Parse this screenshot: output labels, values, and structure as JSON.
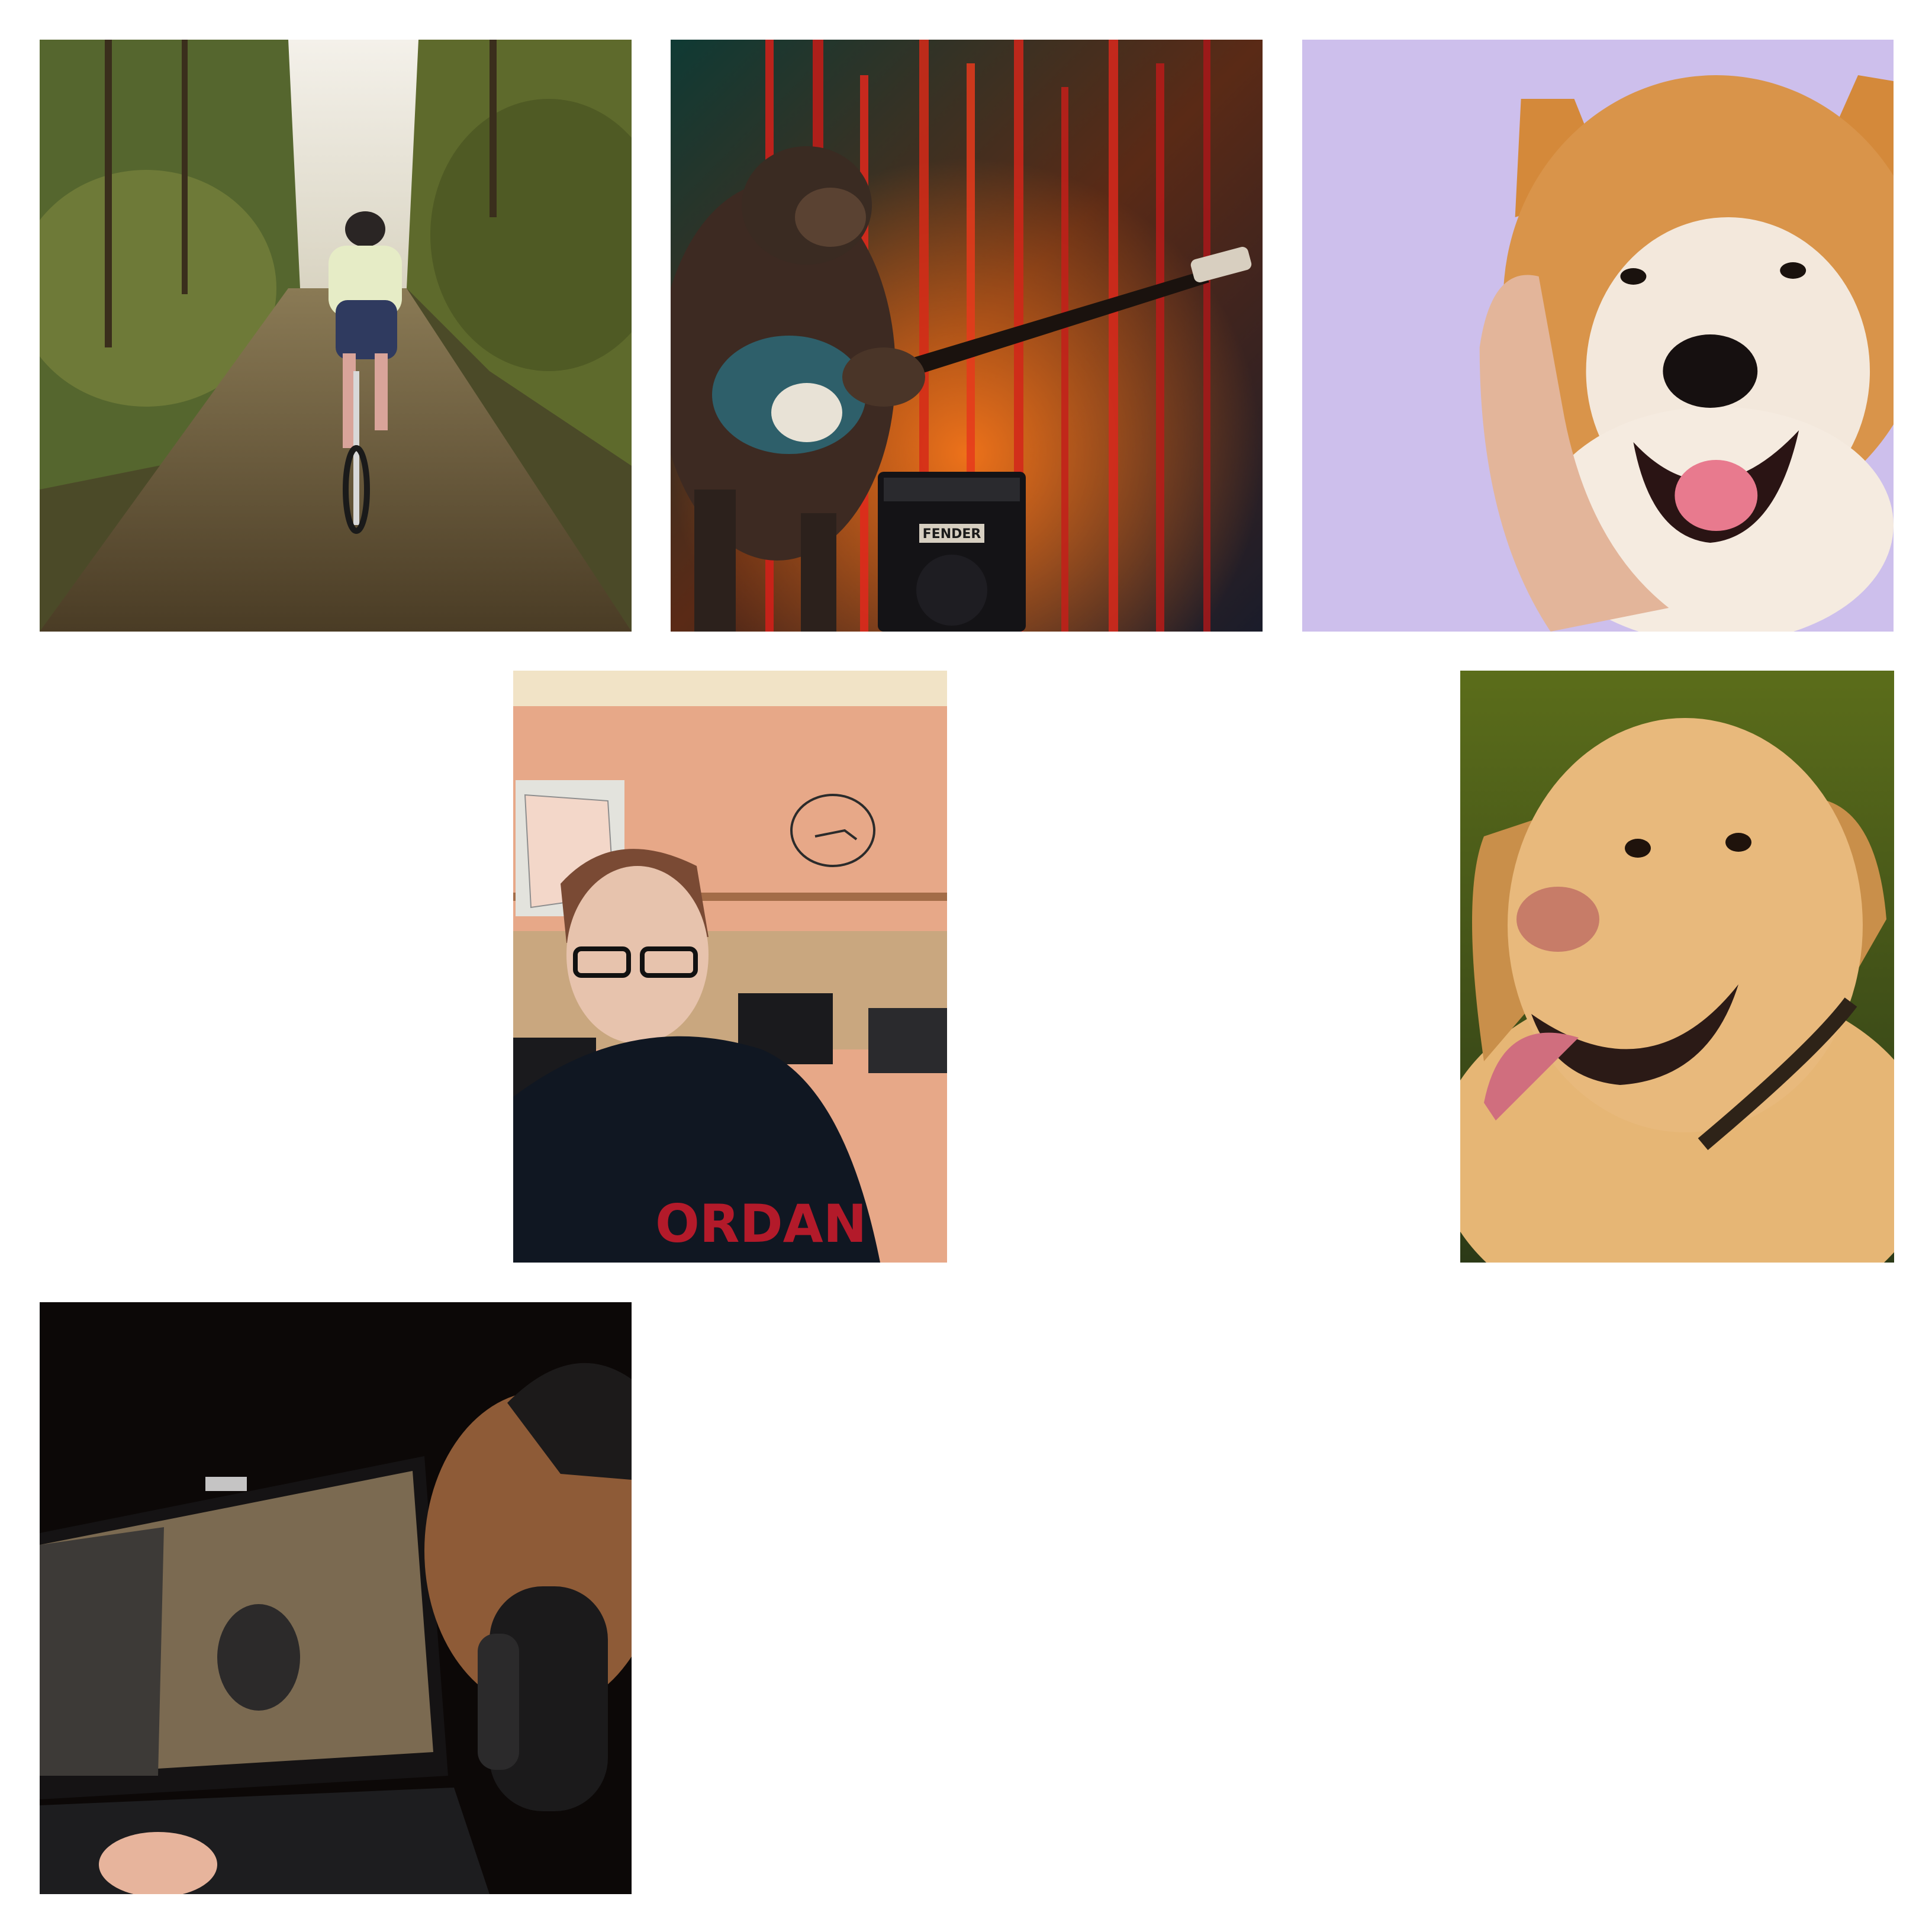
{
  "gallery": {
    "tiles": [
      {
        "subject": "cyclist-on-forest-trail",
        "background": "#5f5a34"
      },
      {
        "subject": "chimpanzee-playing-guitar",
        "background": "#2b1b1a",
        "amp_label": "FENDER"
      },
      {
        "subject": "shiba-inu-with-hand",
        "background": "#cbbde9"
      },
      {
        "subject": "boy-selfie-in-classroom",
        "background": "#e8a985"
      },
      {
        "subject": "golden-labrador",
        "background": "#4d5a21"
      },
      {
        "subject": "laptop-gaming-with-headphones",
        "background": "#0d0807"
      }
    ]
  }
}
